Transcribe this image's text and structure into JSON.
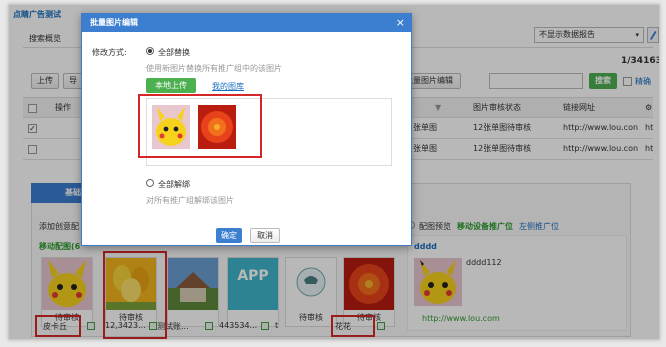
{
  "app": {
    "title": "点睛广告测试",
    "subtitle": "搜索概览"
  },
  "filter": {
    "selected": "不显示数据报告"
  },
  "pagination": {
    "text": "1/34163"
  },
  "toolbar": {
    "upload": "上传",
    "cut": "导",
    "batch_edit": "批量图片编辑",
    "search": "搜索",
    "exact": "精确"
  },
  "table": {
    "headers": {
      "op": "操作",
      "review_status": "图片审核状态",
      "link": "链接网址",
      "more": "ht"
    },
    "rows": [
      {
        "name": "张单图",
        "status": "12张单图待审核",
        "url": "http://www.lou.con",
        "more": "ht"
      },
      {
        "name": "张单图",
        "status": "12张单图待审核",
        "url": "http://www.lou.con",
        "more": "ht"
      }
    ]
  },
  "lower": {
    "tab": "基础",
    "add_creative": "添加创意配",
    "mobile_count": "移动配图(6",
    "preview_label": "配图预览",
    "mobile_slot": "移动设备推广位",
    "left_slot": "左侧推广位",
    "preview_title": "dddd",
    "preview_text": "dddd112",
    "preview_url": "http://www.lou.com",
    "cards": [
      {
        "status": "待审核",
        "caption": "皮卡丘"
      },
      {
        "status": "待审核",
        "caption": "12,3423..."
      },
      {
        "status": "",
        "caption": "测试账..."
      },
      {
        "status": "",
        "caption": "443534..."
      },
      {
        "status": "待审核",
        "caption": "t"
      },
      {
        "status": "待审核",
        "caption": "花花"
      }
    ],
    "app_tile": "APP"
  },
  "dialog": {
    "title": "批量图片编辑",
    "mode_label": "修改方式:",
    "opt_replace": "全部替换",
    "opt_replace_desc": "使用新图片替换所有推广组中的该图片",
    "local_upload": "本地上传",
    "my_gallery": "我的图库",
    "opt_unbind": "全部解绑",
    "opt_unbind_desc": "对所有推广组解绑该图片",
    "confirm": "确定",
    "cancel": "取消"
  },
  "colors": {
    "accent": "#3c7fd0",
    "green": "#4caf50",
    "highlight": "#d62727"
  }
}
